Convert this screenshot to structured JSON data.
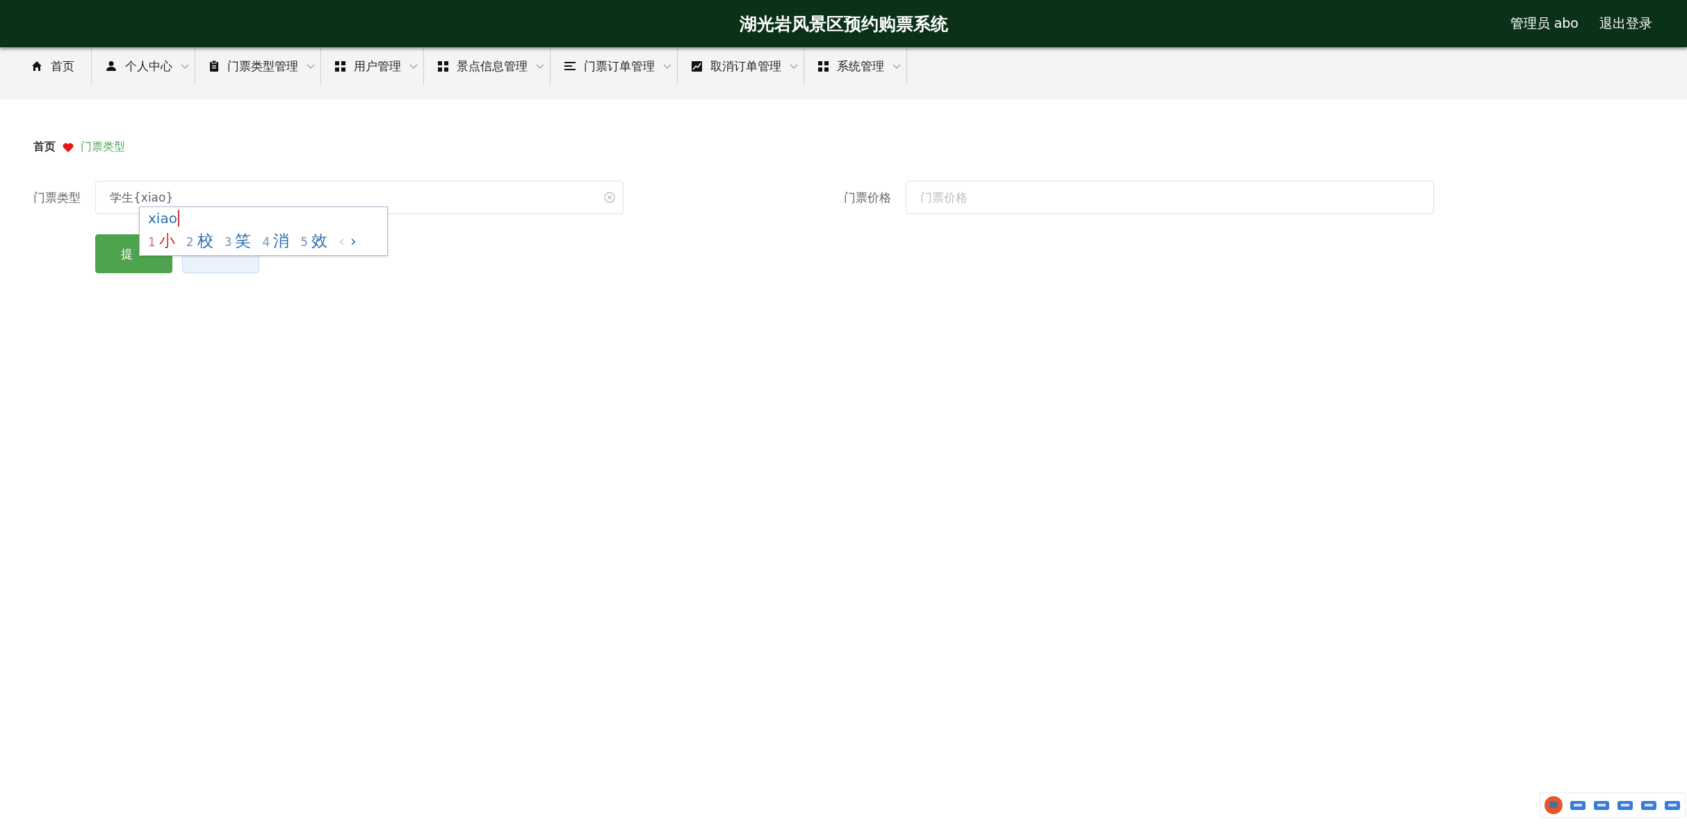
{
  "header": {
    "title": "湖光岩风景区预约购票系统",
    "user": "管理员 abo",
    "logout": "退出登录"
  },
  "nav": [
    {
      "label": "首页",
      "kind": "home",
      "dropdown": false
    },
    {
      "label": "个人中心",
      "kind": "user",
      "dropdown": true
    },
    {
      "label": "门票类型管理",
      "kind": "clipboard",
      "dropdown": true
    },
    {
      "label": "用户管理",
      "kind": "grid",
      "dropdown": true
    },
    {
      "label": "景点信息管理",
      "kind": "grid",
      "dropdown": true
    },
    {
      "label": "门票订单管理",
      "kind": "lines",
      "dropdown": true
    },
    {
      "label": "取消订单管理",
      "kind": "chart",
      "dropdown": true
    },
    {
      "label": "系统管理",
      "kind": "grid",
      "dropdown": true
    }
  ],
  "breadcrumb": {
    "home": "首页",
    "current": "门票类型"
  },
  "form": {
    "fields": [
      {
        "label": "门票类型",
        "value": "学生{xiao}"
      },
      {
        "label": "门票价格",
        "placeholder": "门票价格"
      }
    ],
    "buttons": [
      {
        "label": "提",
        "kind": "primary"
      },
      {
        "kind": "secondary"
      }
    ]
  },
  "ime": {
    "composition": "xiao",
    "candidates": [
      {
        "number": "1",
        "char": "小",
        "selected": true
      },
      {
        "number": "2",
        "char": "校",
        "selected": false
      },
      {
        "number": "3",
        "char": "笑",
        "selected": false
      },
      {
        "number": "4",
        "char": "消",
        "selected": false
      },
      {
        "number": "5",
        "char": "效",
        "selected": false
      }
    ],
    "prev": "‹",
    "next": "›",
    "prev_disabled": true
  }
}
